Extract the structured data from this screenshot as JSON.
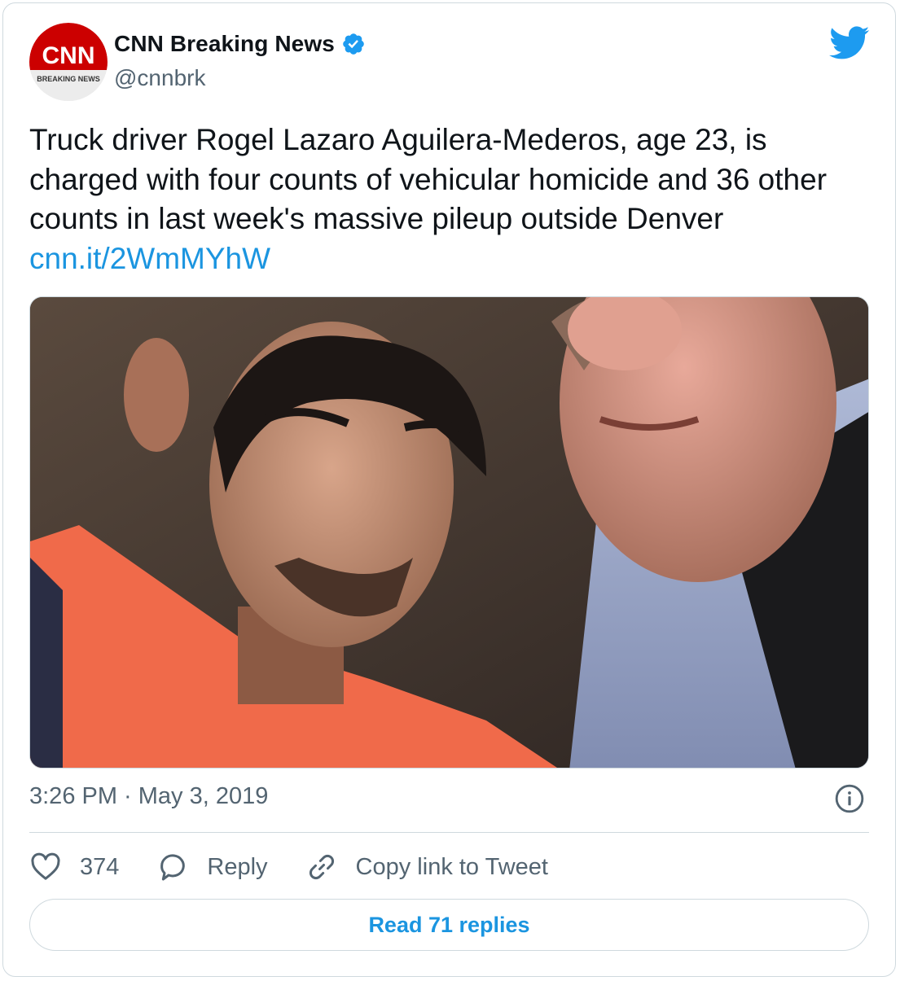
{
  "author": {
    "display_name": "CNN Breaking News",
    "handle": "@cnnbrk",
    "avatar_logo_text": "CNN",
    "avatar_subtext": "BREAKING NEWS"
  },
  "tweet": {
    "text": "Truck driver Rogel Lazaro Aguilera-Mederos, age 23, is charged with four counts of vehicular homicide and 36 other counts in last week's massive pileup outside Denver",
    "link": "cnn.it/2WmMYhW",
    "timestamp": "3:26 PM · May 3, 2019"
  },
  "actions": {
    "like_count": "374",
    "reply_label": "Reply",
    "copy_link_label": "Copy link to Tweet"
  },
  "read_replies_label": "Read 71 replies",
  "icons": {
    "brand": "twitter-bird-icon",
    "verified": "verified-badge-icon",
    "info": "info-icon",
    "like": "heart-icon",
    "reply": "reply-bubble-icon",
    "copy": "link-icon"
  },
  "colors": {
    "link_blue": "#1b95e0",
    "secondary_text": "#536471",
    "cnn_red": "#cc0000",
    "border": "#cfd9de"
  }
}
